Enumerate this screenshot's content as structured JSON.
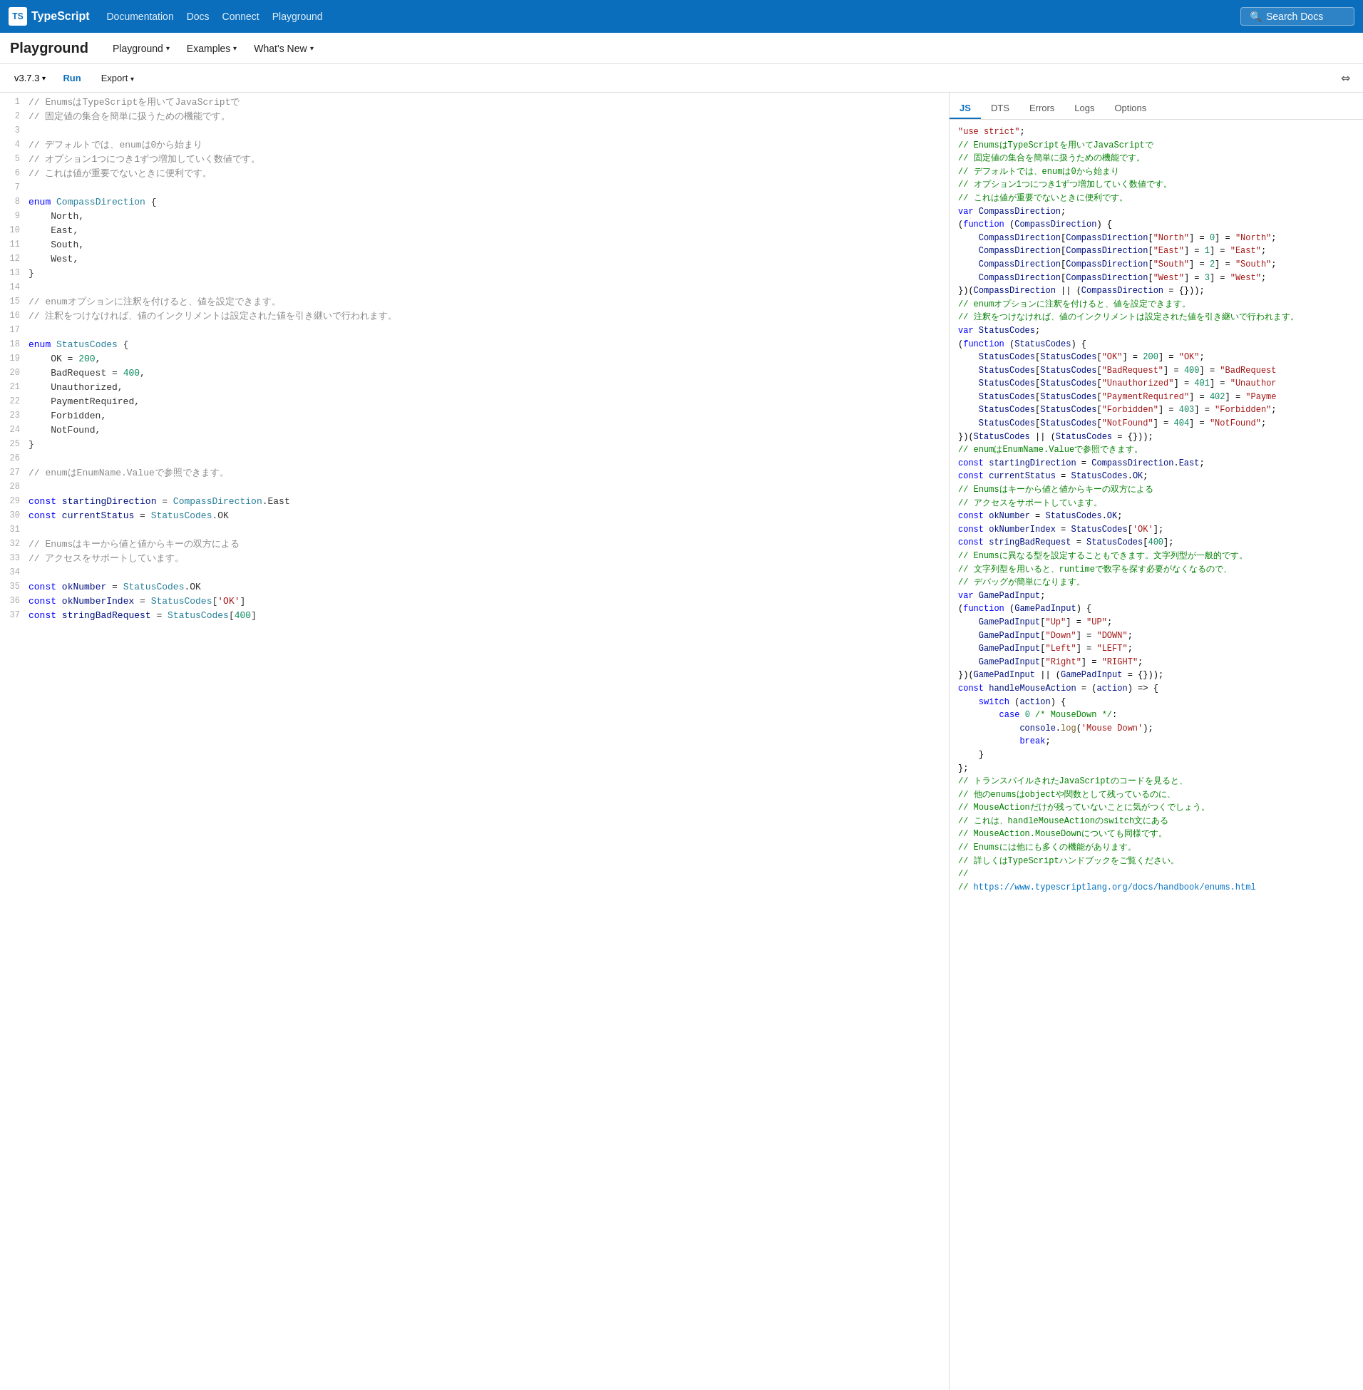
{
  "topNav": {
    "logo": {
      "badge": "TS",
      "title": "TypeScript"
    },
    "links": [
      {
        "label": "Documentation",
        "href": "#"
      },
      {
        "label": "Docs",
        "href": "#"
      },
      {
        "label": "Connect",
        "href": "#"
      },
      {
        "label": "Playground",
        "href": "#"
      }
    ],
    "search": "Search Docs"
  },
  "subNav": {
    "title": "Playground",
    "items": [
      {
        "label": "Playground",
        "hasDropdown": true
      },
      {
        "label": "Examples",
        "hasDropdown": true
      },
      {
        "label": "What's New",
        "hasDropdown": true
      }
    ]
  },
  "toolbar": {
    "version": "v3.7.3",
    "run": "Run",
    "export": "Export",
    "exportHasDropdown": true
  },
  "outputTabs": {
    "tabs": [
      {
        "label": "JS",
        "active": true
      },
      {
        "label": "DTS",
        "active": false
      },
      {
        "label": "Errors",
        "active": false
      },
      {
        "label": "Logs",
        "active": false
      },
      {
        "label": "Options",
        "active": false
      }
    ]
  },
  "editorLines": [
    {
      "num": 1,
      "content": "comment",
      "text": "// EnumsはTypeScriptを用いてJavaScriptで"
    },
    {
      "num": 2,
      "content": "comment",
      "text": "// 固定値の集合を簡単に扱うための機能です。"
    },
    {
      "num": 3,
      "content": "empty",
      "text": ""
    },
    {
      "num": 4,
      "content": "comment",
      "text": "// デフォルトでは、enumは0から始まり"
    },
    {
      "num": 5,
      "content": "comment",
      "text": "// オプション1つにつき1ずつ増加していく数値です。"
    },
    {
      "num": 6,
      "content": "comment",
      "text": "// これは値が重要でないときに便利です。"
    },
    {
      "num": 7,
      "content": "empty",
      "text": ""
    },
    {
      "num": 8,
      "content": "code",
      "text": "enum CompassDirection {"
    },
    {
      "num": 9,
      "content": "code",
      "text": "    North,"
    },
    {
      "num": 10,
      "content": "code",
      "text": "    East,"
    },
    {
      "num": 11,
      "content": "code",
      "text": "    South,"
    },
    {
      "num": 12,
      "content": "code",
      "text": "    West,"
    },
    {
      "num": 13,
      "content": "code",
      "text": "}"
    },
    {
      "num": 14,
      "content": "empty",
      "text": ""
    },
    {
      "num": 15,
      "content": "comment",
      "text": "// enumオプションに注釈を付けると、値を設定できます。"
    },
    {
      "num": 16,
      "content": "comment",
      "text": "// 注釈をつけなければ、値のインクリメントは設定された値を引き継いで行われます。"
    },
    {
      "num": 17,
      "content": "empty",
      "text": ""
    },
    {
      "num": 18,
      "content": "code",
      "text": "enum StatusCodes {"
    },
    {
      "num": 19,
      "content": "code",
      "text": "    OK = 200,"
    },
    {
      "num": 20,
      "content": "code",
      "text": "    BadRequest = 400,"
    },
    {
      "num": 21,
      "content": "code",
      "text": "    Unauthorized,"
    },
    {
      "num": 22,
      "content": "code",
      "text": "    PaymentRequired,"
    },
    {
      "num": 23,
      "content": "code",
      "text": "    Forbidden,"
    },
    {
      "num": 24,
      "content": "code",
      "text": "    NotFound,"
    },
    {
      "num": 25,
      "content": "code",
      "text": "}"
    },
    {
      "num": 26,
      "content": "empty",
      "text": ""
    },
    {
      "num": 27,
      "content": "comment",
      "text": "// enumはEnumName.Valueで参照できます。"
    },
    {
      "num": 28,
      "content": "empty",
      "text": ""
    },
    {
      "num": 29,
      "content": "code",
      "text": "const startingDirection = CompassDirection.East"
    },
    {
      "num": 30,
      "content": "code",
      "text": "const currentStatus = StatusCodes.OK"
    },
    {
      "num": 31,
      "content": "empty",
      "text": ""
    },
    {
      "num": 32,
      "content": "comment",
      "text": "// Enumsはキーから値と値からキーの双方による"
    },
    {
      "num": 33,
      "content": "comment",
      "text": "// アクセスをサポートしています。"
    },
    {
      "num": 34,
      "content": "empty",
      "text": ""
    },
    {
      "num": 35,
      "content": "code",
      "text": "const okNumber = StatusCodes.OK"
    },
    {
      "num": 36,
      "content": "code",
      "text": "const okNumberIndex = StatusCodes['OK']"
    },
    {
      "num": 37,
      "content": "code",
      "text": "const stringBadRequest = StatusCodes[400]"
    }
  ]
}
